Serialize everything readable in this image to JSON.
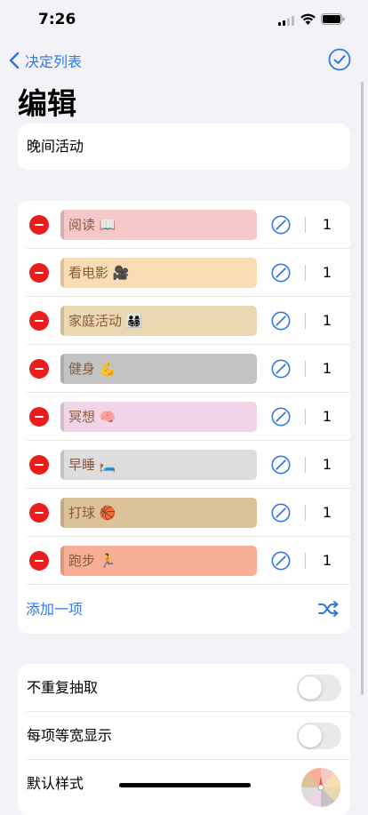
{
  "status": {
    "time": "7:26"
  },
  "nav": {
    "back_label": "决定列表",
    "back_icon": "chevron-left-icon",
    "done_icon": "checkmark-circle-icon"
  },
  "page_title": "编辑",
  "list_name": "晚间活动",
  "items": [
    {
      "label": "阅读 📖",
      "weight": "1",
      "color": "#f5c9c9"
    },
    {
      "label": "看电影 🎥",
      "weight": "1",
      "color": "#f7dcb4"
    },
    {
      "label": "家庭活动 👨‍👩‍👧‍👦",
      "weight": "1",
      "color": "#ead8b3"
    },
    {
      "label": "健身 💪",
      "weight": "1",
      "color": "#c3c3c3"
    },
    {
      "label": "冥想 🧠",
      "weight": "1",
      "color": "#efd5e7"
    },
    {
      "label": "早睡 🛏️",
      "weight": "1",
      "color": "#dddddd"
    },
    {
      "label": "打球 🏀",
      "weight": "1",
      "color": "#dcc299"
    },
    {
      "label": "跑步 🏃",
      "weight": "1",
      "color": "#f6ae95"
    }
  ],
  "add_item_label": "添加一项",
  "settings": {
    "no_repeat_label": "不重复抽取",
    "no_repeat_on": false,
    "equal_width_label": "每项等宽显示",
    "equal_width_on": false,
    "default_style_label": "默认样式"
  },
  "colors": {
    "accent": "#2f78e8",
    "delete": "#ea1c1c",
    "label_text": "#8b5b3a"
  }
}
